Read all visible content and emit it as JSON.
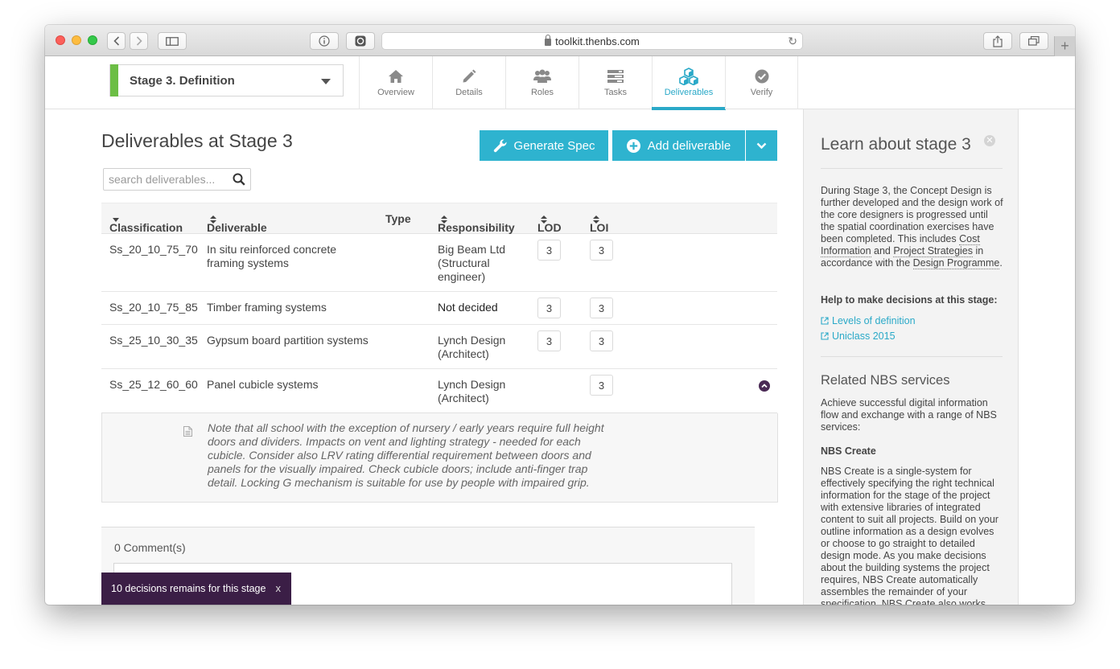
{
  "browser": {
    "url": "toolkit.thenbs.com"
  },
  "stage_select": {
    "label": "Stage 3. Definition"
  },
  "tabs": [
    {
      "label": "Overview",
      "icon": "home-icon",
      "active": false
    },
    {
      "label": "Details",
      "icon": "pencil-icon",
      "active": false
    },
    {
      "label": "Roles",
      "icon": "people-icon",
      "active": false
    },
    {
      "label": "Tasks",
      "icon": "tasks-icon",
      "active": false
    },
    {
      "label": "Deliverables",
      "icon": "cubes-icon",
      "active": true
    },
    {
      "label": "Verify",
      "icon": "check-circle-icon",
      "active": false
    }
  ],
  "main": {
    "title": "Deliverables at Stage 3",
    "generate_spec_label": "Generate Spec",
    "add_deliverable_label": "Add deliverable",
    "search_placeholder": "search deliverables...",
    "columns": {
      "classification": "Classification",
      "deliverable": "Deliverable",
      "type": "Type",
      "responsibility": "Responsibility",
      "lod": "LOD",
      "loi": "LOI"
    },
    "rows": [
      {
        "classification": "Ss_20_10_75_70",
        "deliverable": "In situ reinforced concrete framing systems",
        "type": "",
        "responsibility": "Big Beam Ltd (Structural engineer)",
        "lod": "3",
        "loi": "3"
      },
      {
        "classification": "Ss_20_10_75_85",
        "deliverable": "Timber framing systems",
        "type": "",
        "responsibility": "Not decided",
        "lod": "3",
        "loi": "3"
      },
      {
        "classification": "Ss_25_10_30_35",
        "deliverable": "Gypsum board partition systems",
        "type": "",
        "responsibility": "Lynch Design (Architect)",
        "lod": "3",
        "loi": "3"
      },
      {
        "classification": "Ss_25_12_60_60",
        "deliverable": "Panel cubicle systems",
        "type": "",
        "responsibility": "Lynch Design (Architect)",
        "lod": "",
        "loi": "3"
      }
    ],
    "note": "Note that all school with the exception of nursery / early years require full height doors and dividers. Impacts on vent and lighting strategy - needed for each cubicle. Consider also LRV rating differential requirement between doors and panels for the visually impaired. Check cubicle doors; include anti-finger trap detail. Locking G mechanism is suitable for use by people with impaired grip.",
    "comments_label": "0 Comment(s)"
  },
  "toast": {
    "text": "10 decisions remains for this stage",
    "close": "x"
  },
  "sidebar": {
    "title": "Learn about stage 3",
    "intro_1": "During Stage 3, the Concept Design is further developed and the design work of the core designers is progressed until the spatial coordination exercises have been completed. This includes ",
    "link_cost": "Cost Information",
    "and": " and ",
    "link_strategies": "Project Strategies",
    "intro_2": " in accordance with the ",
    "link_programme": "Design Programme",
    "period": ".",
    "help_heading": "Help to make decisions at this stage:",
    "links": [
      "Levels of definition",
      "Uniclass 2015"
    ],
    "related_title": "Related NBS services",
    "related_text": "Achieve successful digital information flow and exchange with a range of NBS services:",
    "create_heading": "NBS Create",
    "create_text": "NBS Create is a single-system for effectively specifying the right technical information for the stage of the project with extensive libraries of integrated content to suit all projects. Build on your outline information as a design evolves or choose to go straight to detailed design mode. As you make decisions about the building systems the project requires, NBS Create automatically assembles the remainder of your specification. NBS Create also works"
  },
  "colors": {
    "accent": "#2eb3cf",
    "stage_green": "#6cbe45",
    "toast_bg": "#3b1e46"
  }
}
